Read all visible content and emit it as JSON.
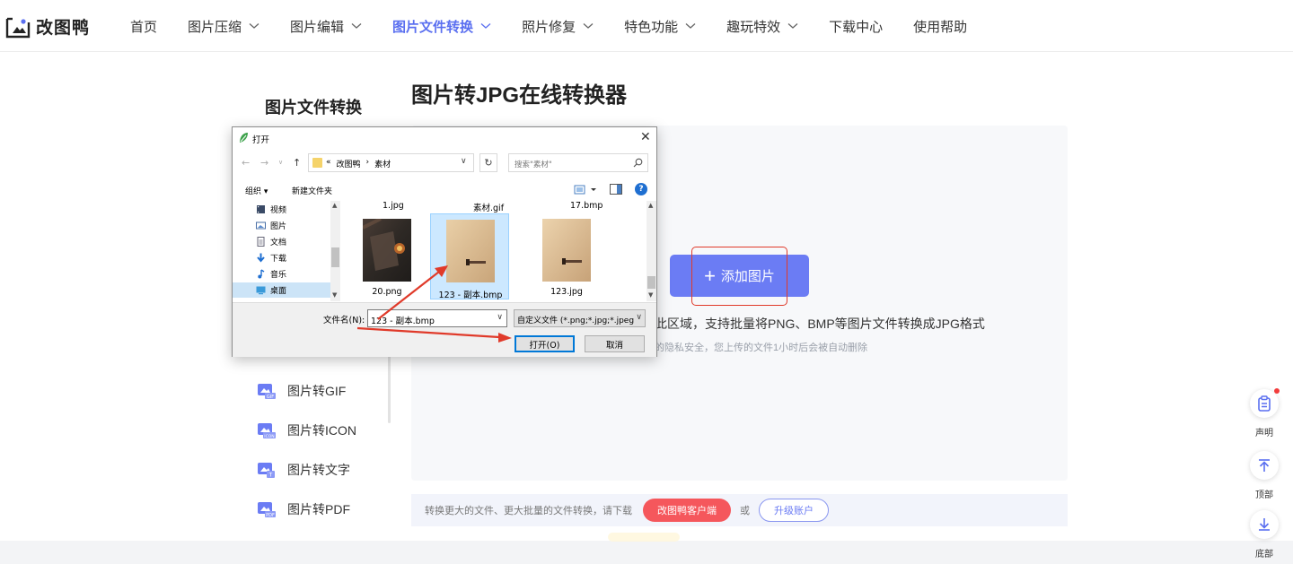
{
  "brand": {
    "name": "改图鸭"
  },
  "nav": {
    "items": [
      {
        "label": "首页",
        "has_dropdown": false,
        "active": false
      },
      {
        "label": "图片压缩",
        "has_dropdown": true,
        "active": false
      },
      {
        "label": "图片编辑",
        "has_dropdown": true,
        "active": false
      },
      {
        "label": "图片文件转换",
        "has_dropdown": true,
        "active": true
      },
      {
        "label": "照片修复",
        "has_dropdown": true,
        "active": false
      },
      {
        "label": "特色功能",
        "has_dropdown": true,
        "active": false
      },
      {
        "label": "趣玩特效",
        "has_dropdown": true,
        "active": false
      },
      {
        "label": "下载中心",
        "has_dropdown": false,
        "active": false
      },
      {
        "label": "使用帮助",
        "has_dropdown": false,
        "active": false
      }
    ]
  },
  "sidebar": {
    "title": "图片文件转换",
    "items": [
      {
        "label": "图片转GIF",
        "icon": "gif-convert-icon",
        "badge": "GIF"
      },
      {
        "label": "图片转ICON",
        "icon": "icon-convert-icon",
        "badge": "ICON"
      },
      {
        "label": "图片转文字",
        "icon": "text-convert-icon",
        "badge": "T"
      },
      {
        "label": "图片转PDF",
        "icon": "pdf-convert-icon",
        "badge": "PDF"
      }
    ]
  },
  "main": {
    "title": "图片转JPG在线转换器",
    "add_button": "添加图片",
    "drop_hint": "此区域，支持批量将PNG、BMP等图片文件转换成JPG格式",
    "privacy_note": "的隐私安全，您上传的文件1小时后会被自动删除"
  },
  "promo": {
    "text": "转换更大的文件、更大批量的文件转换，请下载",
    "client_button": "改图鸭客户端",
    "or": "或",
    "upgrade_button": "升级账户"
  },
  "float_tools": [
    {
      "label": "声明",
      "icon": "notice-icon",
      "has_dot": true
    },
    {
      "label": "顶部",
      "icon": "to-top-icon",
      "has_dot": false
    },
    {
      "label": "底部",
      "icon": "to-bottom-icon",
      "has_dot": false
    }
  ],
  "dialog": {
    "title": "打开",
    "path": [
      "«",
      "改图鸭",
      "›",
      "素材"
    ],
    "search_placeholder": "搜索\"素材\"",
    "organize": "组织 ▾",
    "new_folder": "新建文件夹",
    "help": "?",
    "tree": [
      "视频",
      "图片",
      "文档",
      "下载",
      "音乐",
      "桌面"
    ],
    "top_row_names": [
      "1.jpg",
      "素材.gif",
      "17.bmp"
    ],
    "files": [
      {
        "name": "20.png",
        "selected": false,
        "kind": "dark-photo"
      },
      {
        "name": "123 - 副本.bmp",
        "selected": true,
        "kind": "paper"
      },
      {
        "name": "123.jpg",
        "selected": false,
        "kind": "paper"
      }
    ],
    "filename_label": "文件名(N):",
    "filename_value": "123 - 副本.bmp",
    "filetype_value": "自定义文件 (*.png;*.jpg;*.jpeg",
    "open_button": "打开(O)",
    "cancel_button": "取消"
  },
  "colors": {
    "accent": "#6b7cf4",
    "nav_active": "#5a6ff0",
    "client_button": "#f5575c",
    "annotation_red": "#e03a2a",
    "selection_blue": "#cce8ff"
  }
}
